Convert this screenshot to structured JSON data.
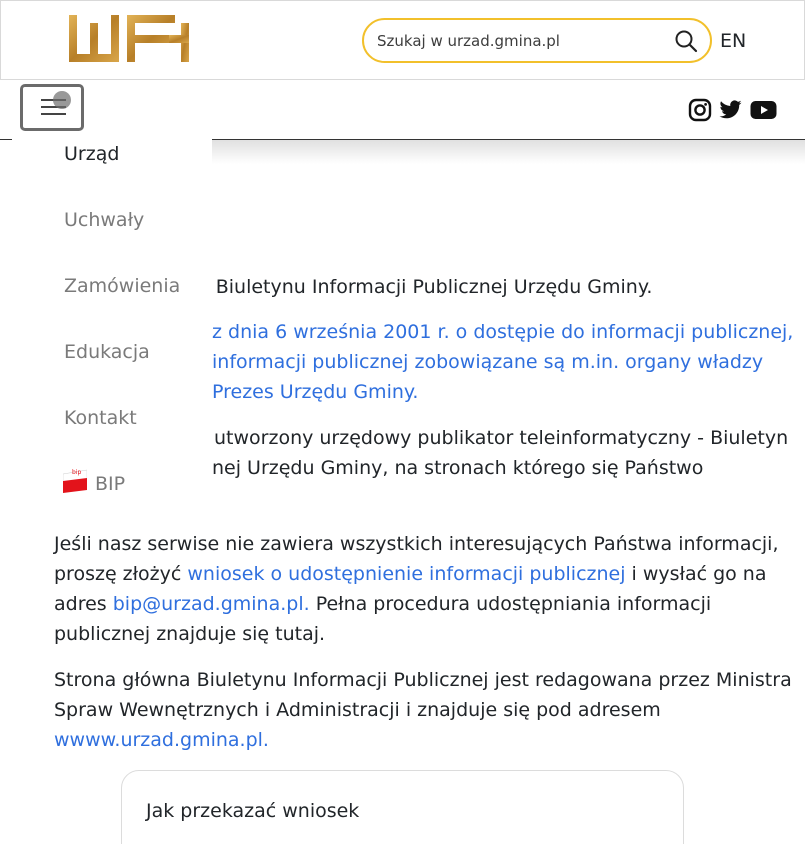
{
  "header": {
    "logo_name": "logo",
    "search": {
      "placeholder": "Szukaj w urzad.gmina.pl",
      "value": ""
    },
    "language": "EN"
  },
  "navbar": {
    "social": [
      "instagram-icon",
      "twitter-icon",
      "youtube-icon"
    ]
  },
  "menu": {
    "items": [
      {
        "label": "Urząd",
        "active": true
      },
      {
        "label": "Uchwały"
      },
      {
        "label": "Zamówienia"
      },
      {
        "label": "Edukacja"
      },
      {
        "label": "Kontakt"
      },
      {
        "label": "BIP",
        "icon": "bip-icon"
      }
    ],
    "bip_icon_text": "bip"
  },
  "main": {
    "p1_visible": "e Biuletynu Informacji Publicznej Urzędu Gminy.",
    "p2_line1": "z dnia 6 września 2001 r. o dostępie do informacji publicznej,",
    "p2_line2": "informacji publicznej zobowiązane są m.in. organy władzy",
    "p2_line3": "Prezes Urzędu Gminy.",
    "p3_line1": "utworzony urzędowy publikator teleinformatyczny - Biuletyn",
    "p3_line2": "nej Urzędu Gminy, na stronach którego się Państwo",
    "p4_line1": "Jeśli nasz serwise nie zawiera wszystkich interesujących Państwa informacji,",
    "p4_line2_pre": "proszę złożyć ",
    "p4_line2_link": "wniosek o udostępnienie informacji publicznej",
    "p4_line2_post": " i wysłać go na",
    "p4_line3_pre": "adres ",
    "p4_line3_link": "bip@urzad.gmina.pl.",
    "p4_line3_post": " Pełna procedura udostępniania informacji",
    "p4_line4": "publicznej znajduje się tutaj.",
    "p5_line1": "Strona główna Biuletynu Informacji Publicznej jest redagowana przez Ministra",
    "p5_line2": "Spraw Wewnętrznych i Administracji i znajduje się pod adresem",
    "p5_link": "wwww.urzad.gmina.pl."
  },
  "card": {
    "title": "Jak przekazać wniosek"
  },
  "colors": {
    "accent": "#f2c02b",
    "link": "#2f6fde",
    "logo_gold": "#c8902f"
  }
}
